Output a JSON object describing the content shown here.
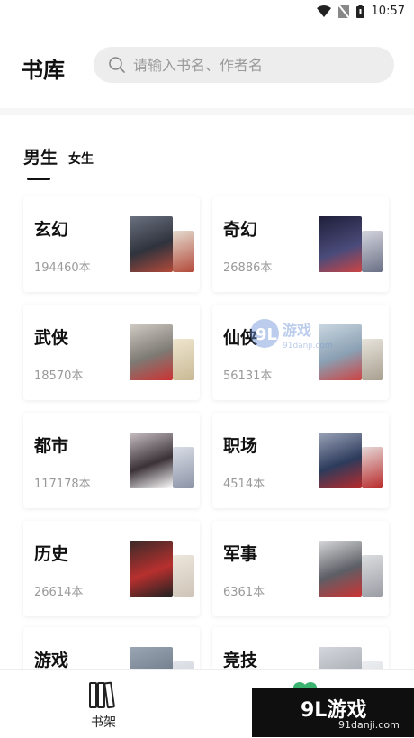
{
  "status_bar": {
    "time": "10:57"
  },
  "header": {
    "title": "书库",
    "search_placeholder": "请输入书名、作者名"
  },
  "tabs": [
    {
      "label": "男生",
      "active": true
    },
    {
      "label": "女生",
      "active": false
    }
  ],
  "categories": [
    {
      "name": "玄幻",
      "count": "194460本",
      "colors": [
        "#4a4f5c",
        "#b34a3a"
      ]
    },
    {
      "name": "奇幻",
      "count": "26886本",
      "colors": [
        "#2f2f55",
        "#6a6f85"
      ]
    },
    {
      "name": "武侠",
      "count": "18570本",
      "colors": [
        "#7e7a74",
        "#c9b995"
      ]
    },
    {
      "name": "仙侠",
      "count": "56131本",
      "colors": [
        "#8aa0b3",
        "#d7d2c8"
      ]
    },
    {
      "name": "都市",
      "count": "117178本",
      "colors": [
        "#3b3238",
        "#8b93a6"
      ]
    },
    {
      "name": "职场",
      "count": "4514本",
      "colors": [
        "#2d3b5c",
        "#b82a2a"
      ]
    },
    {
      "name": "历史",
      "count": "26614本",
      "colors": [
        "#b7302e",
        "#cfc4b7"
      ]
    },
    {
      "name": "军事",
      "count": "6361本",
      "colors": [
        "#5c5f66",
        "#9a9da4"
      ]
    },
    {
      "name": "游戏",
      "count": "",
      "colors": [
        "#54606e",
        "#c4c8d0"
      ]
    },
    {
      "name": "竞技",
      "count": "",
      "colors": [
        "#8a8f99",
        "#d0d3d8"
      ]
    }
  ],
  "bottom_nav": {
    "shelf_label": "书架",
    "library_accent": "#3cb371"
  },
  "watermark": {
    "center_text": "9L游戏",
    "center_sub": "91danji.com",
    "logo_text": "9L游戏",
    "logo_url": "91danji.com"
  }
}
